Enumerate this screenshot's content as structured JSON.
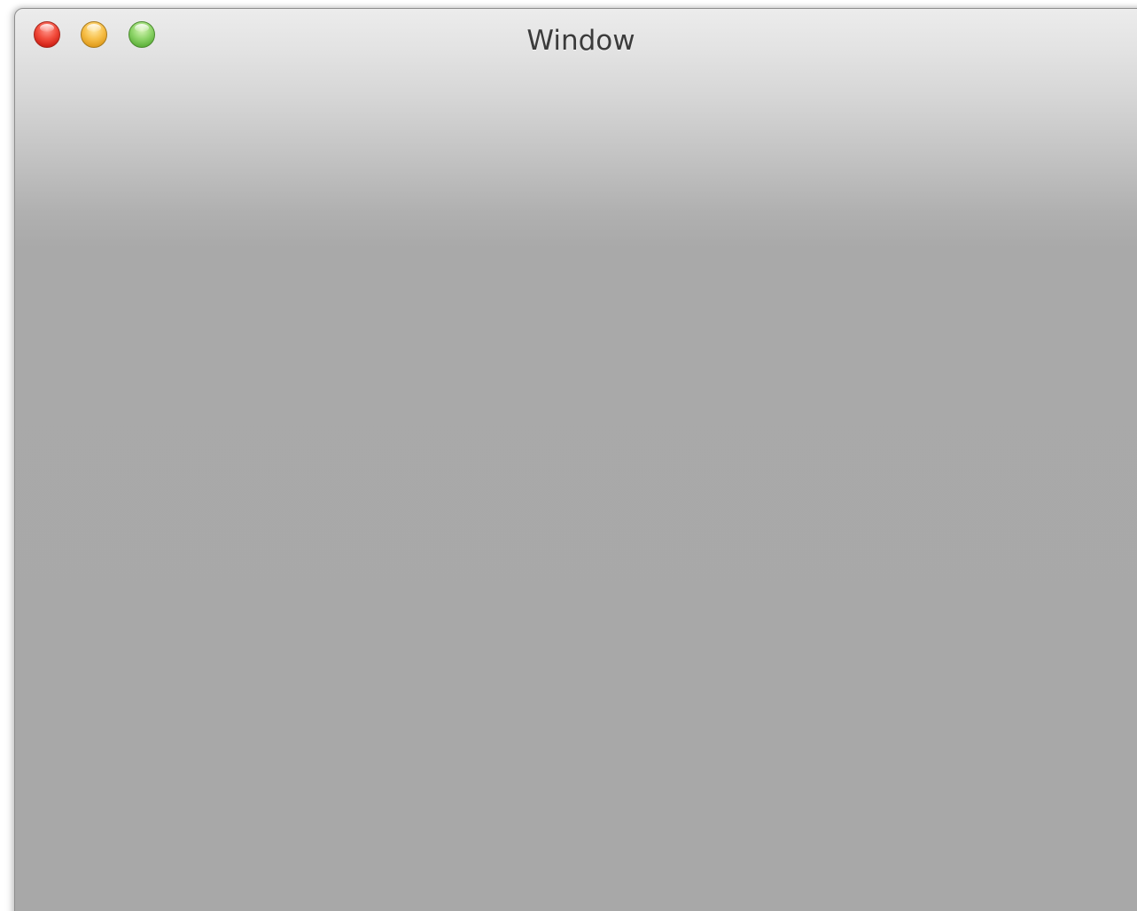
{
  "window": {
    "title": "Window",
    "controls": {
      "close": "close-button",
      "minimize": "minimize-button",
      "zoom": "zoom-button"
    }
  },
  "colors": {
    "close": "#f24c3c",
    "minimize": "#f7c04a",
    "zoom": "#8fd56a",
    "titlebar_top": "#ececec",
    "content_bg": "#a8a8a8",
    "title_text": "#3b3b3b"
  }
}
